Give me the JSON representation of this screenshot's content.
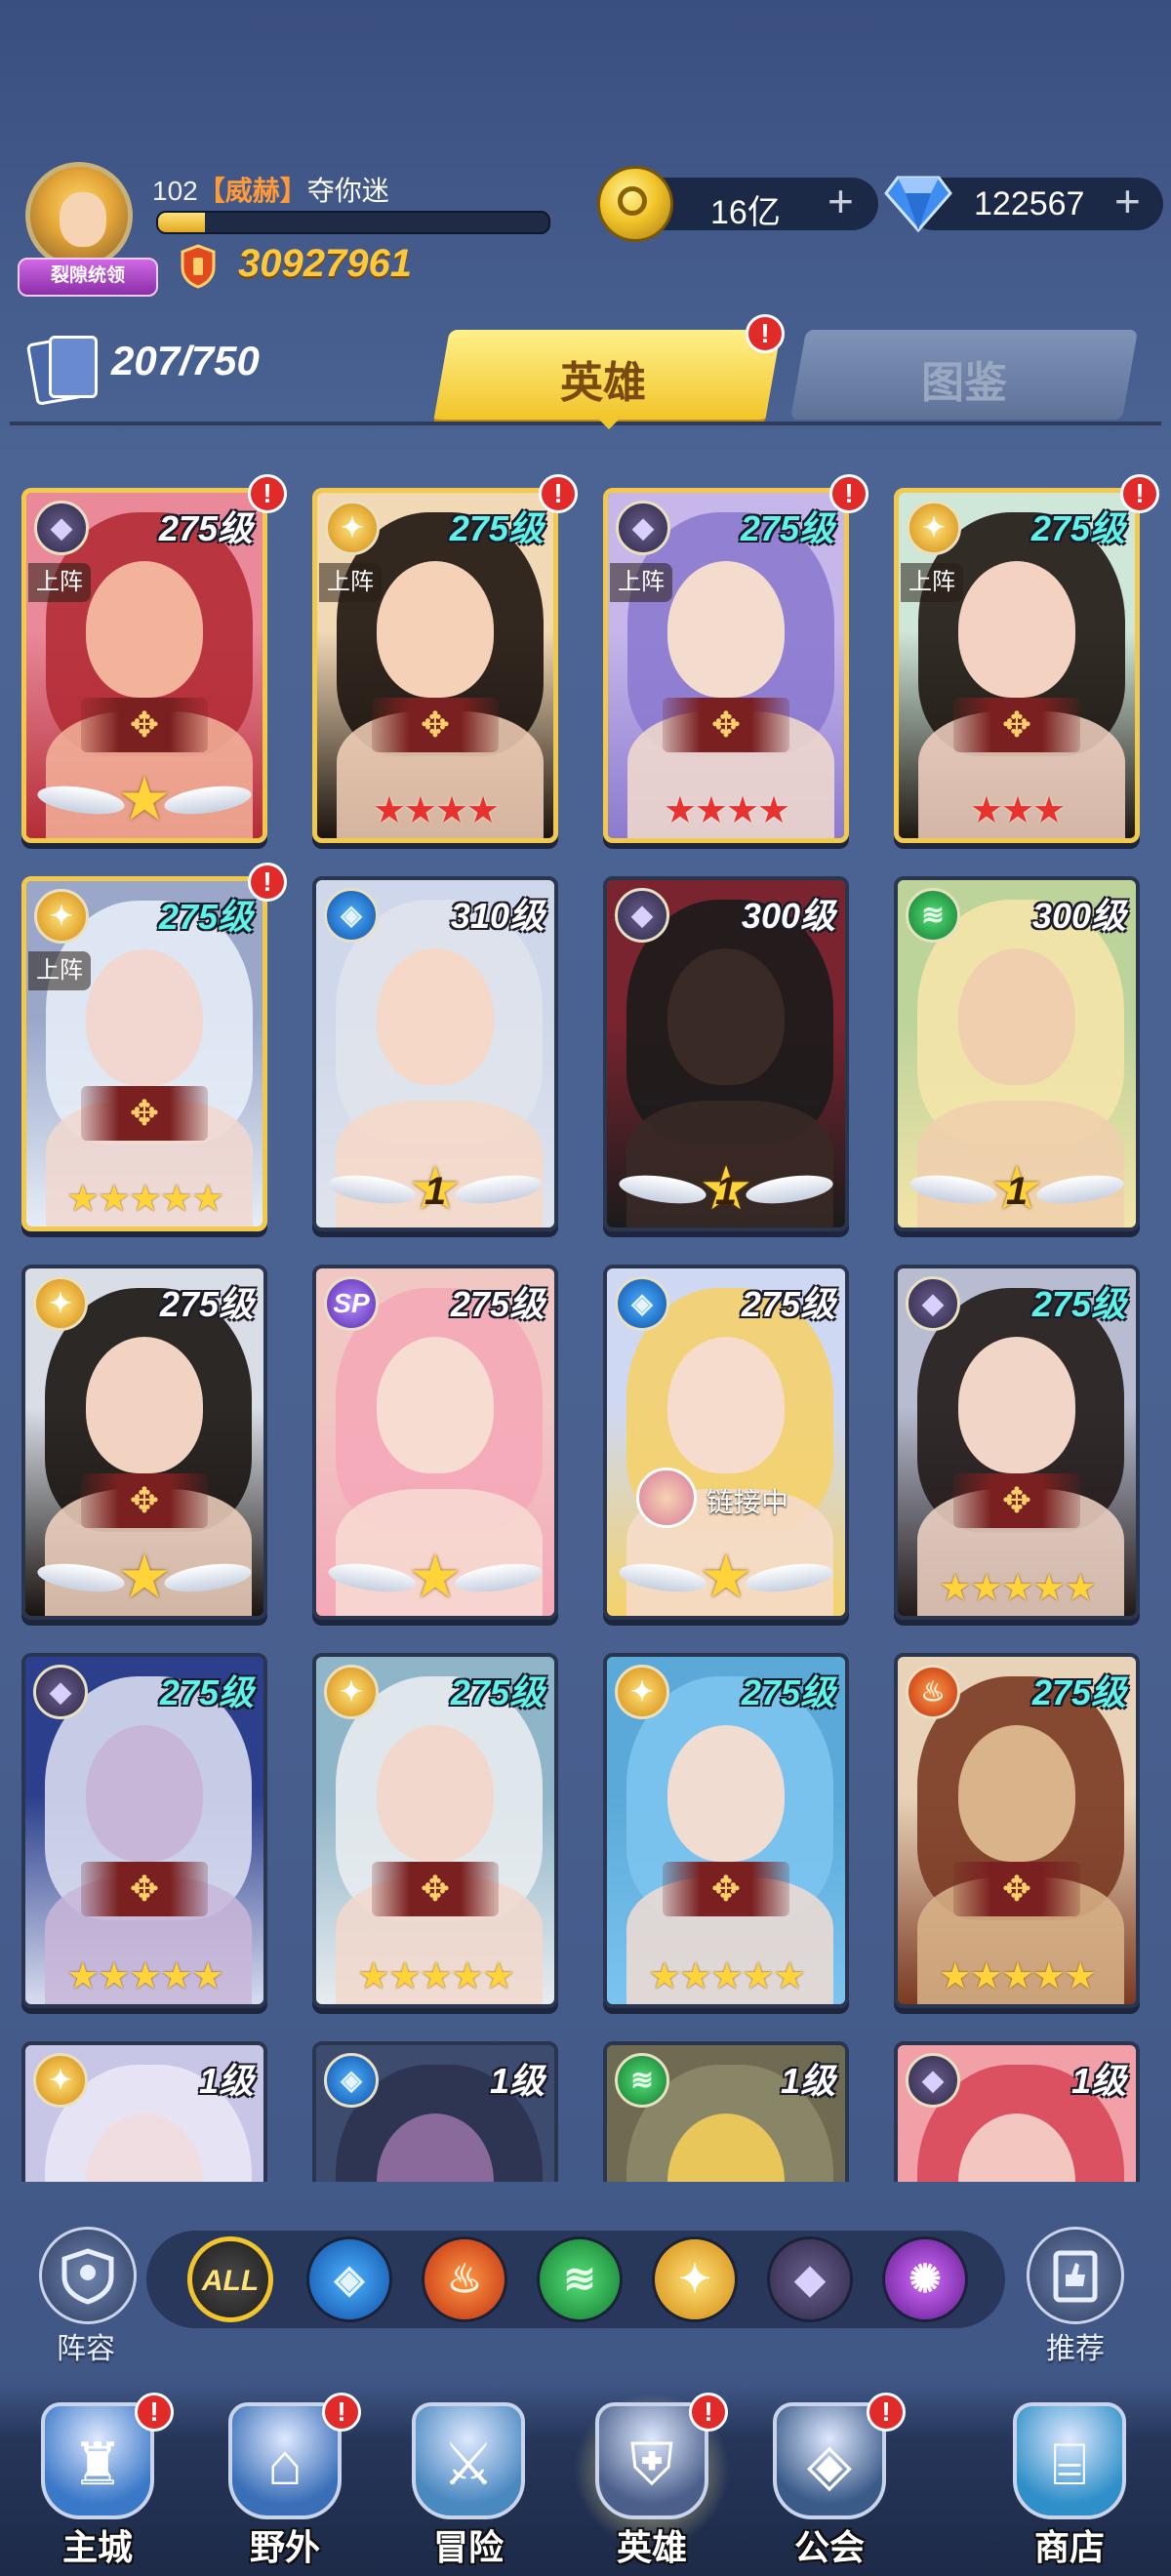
{
  "player": {
    "level": "102",
    "guild": "【威赫】",
    "name": "夺你迷",
    "title_badge": "裂隙统领",
    "xp_fraction": 0.12,
    "power": "30927961"
  },
  "resources": {
    "gold": "16亿",
    "gems": "122567",
    "plus": "+"
  },
  "hero_count": "207/750",
  "tabs": {
    "heroes": "英雄",
    "codex": "图鉴"
  },
  "deploy_label": "上阵",
  "linking_label": "链接中",
  "heroes": [
    {
      "level": "275级",
      "color": "white",
      "faction": "dark",
      "deployed": true,
      "stars": "wing",
      "stars_count": 0,
      "badge": true,
      "art": [
        "#e9899a",
        "#b42c36",
        "#f3b39a"
      ]
    },
    {
      "level": "275级",
      "color": "cyan",
      "faction": "light",
      "deployed": true,
      "stars": "red",
      "stars_count": 4,
      "badge": true,
      "art": [
        "#f1d9b5",
        "#1d1410",
        "#f5d1b8"
      ]
    },
    {
      "level": "275级",
      "color": "cyan",
      "faction": "dark",
      "deployed": true,
      "stars": "red",
      "stars_count": 4,
      "badge": true,
      "art": [
        "#c6b6ea",
        "#8c7ad0",
        "#f3dccd"
      ]
    },
    {
      "level": "275级",
      "color": "cyan",
      "faction": "light",
      "deployed": true,
      "stars": "red",
      "stars_count": 3,
      "badge": true,
      "art": [
        "#cfe7d9",
        "#1f1712",
        "#f4d2c2"
      ]
    },
    {
      "level": "275级",
      "color": "cyan",
      "faction": "light",
      "deployed": true,
      "stars": "gold",
      "stars_count": 5,
      "badge": true,
      "art": [
        "#9aa7c9",
        "#e6edf7",
        "#f1d7cf"
      ]
    },
    {
      "level": "310级",
      "color": "white",
      "faction": "water",
      "deployed": false,
      "stars": "wing",
      "stars_count": 1,
      "badge": false,
      "art": [
        "#cfd8ea",
        "#dfe3ec",
        "#f6d8c8"
      ]
    },
    {
      "level": "300级",
      "color": "white",
      "faction": "dark",
      "deployed": false,
      "stars": "wing",
      "stars_count": 1,
      "badge": false,
      "art": [
        "#7a2430",
        "#1b1b1b",
        "#3a2a26"
      ]
    },
    {
      "level": "300级",
      "color": "white",
      "faction": "wind",
      "deployed": false,
      "stars": "wing",
      "stars_count": 1,
      "badge": false,
      "art": [
        "#bcd39a",
        "#f4e4a8",
        "#f0cfae"
      ]
    },
    {
      "level": "275级",
      "color": "white",
      "faction": "light",
      "deployed": false,
      "stars": "wing",
      "stars_count": 0,
      "badge": false,
      "art": [
        "#d8dde6",
        "#1a1410",
        "#f2d3c1"
      ]
    },
    {
      "level": "275级",
      "color": "white",
      "faction": "sp",
      "deployed": false,
      "stars": "wing",
      "stars_count": 0,
      "badge": false,
      "art": [
        "#f0c7c3",
        "#f5a8b8",
        "#f7dcd2"
      ]
    },
    {
      "level": "275级",
      "color": "white",
      "faction": "water",
      "deployed": false,
      "stars": "wing",
      "stars_count": 0,
      "badge": false,
      "linking": true,
      "art": [
        "#cfd8f3",
        "#f4d26a",
        "#f6dccd"
      ]
    },
    {
      "level": "275级",
      "color": "cyan",
      "faction": "dark",
      "deployed": false,
      "stars": "gold",
      "stars_count": 5,
      "badge": false,
      "art": [
        "#b7bcd0",
        "#221a18",
        "#f1d5c6"
      ]
    },
    {
      "level": "275级",
      "color": "cyan",
      "faction": "dark",
      "deployed": false,
      "stars": "gold",
      "stars_count": 5,
      "badge": false,
      "art": [
        "#2b3f8c",
        "#d7dcef",
        "#c8b6d8"
      ]
    },
    {
      "level": "275级",
      "color": "cyan",
      "faction": "light",
      "deployed": false,
      "stars": "gold",
      "stars_count": 5,
      "badge": false,
      "art": [
        "#8fb5c8",
        "#e8ecef",
        "#f2d8cc"
      ]
    },
    {
      "level": "275级",
      "color": "cyan",
      "faction": "light",
      "deployed": false,
      "stars": "gold",
      "stars_count": 5,
      "badge": false,
      "art": [
        "#5ba9d8",
        "#7cc4f0",
        "#f1dcd2"
      ]
    },
    {
      "level": "275级",
      "color": "cyan",
      "faction": "fire",
      "deployed": false,
      "stars": "gold",
      "stars_count": 5,
      "badge": false,
      "art": [
        "#e8d3b8",
        "#7a3a22",
        "#d9b48a"
      ]
    },
    {
      "level": "1级",
      "color": "white",
      "faction": "light",
      "deployed": false,
      "stars": "none",
      "stars_count": 0,
      "badge": false,
      "art": [
        "#c8c6e6",
        "#e9e6f6",
        "#f0dde2"
      ]
    },
    {
      "level": "1级",
      "color": "white",
      "faction": "water",
      "deployed": false,
      "stars": "none",
      "stars_count": 0,
      "badge": false,
      "art": [
        "#3d4b6e",
        "#2c3350",
        "#8a6a9a"
      ]
    },
    {
      "level": "1级",
      "color": "white",
      "faction": "wind",
      "deployed": false,
      "stars": "none",
      "stars_count": 0,
      "badge": false,
      "art": [
        "#6f6a52",
        "#8c8a6a",
        "#e9c65a"
      ]
    },
    {
      "level": "1级",
      "color": "white",
      "faction": "dark",
      "deployed": false,
      "stars": "none",
      "stars_count": 0,
      "badge": false,
      "art": [
        "#f0a0a6",
        "#d8485a",
        "#f3c6c0"
      ]
    }
  ],
  "filters": [
    {
      "name": "all",
      "label": "ALL"
    },
    {
      "name": "water",
      "label": ""
    },
    {
      "name": "fire",
      "label": ""
    },
    {
      "name": "wind",
      "label": ""
    },
    {
      "name": "light",
      "label": ""
    },
    {
      "name": "dark",
      "label": ""
    },
    {
      "name": "chaos",
      "label": ""
    }
  ],
  "side_buttons": {
    "lineup": "阵容",
    "recommend": "推荐"
  },
  "nav": [
    {
      "label": "主城",
      "badge": true,
      "active": false
    },
    {
      "label": "野外",
      "badge": true,
      "active": false
    },
    {
      "label": "冒险",
      "badge": false,
      "active": false
    },
    {
      "label": "英雄",
      "badge": true,
      "active": true
    },
    {
      "label": "公会",
      "badge": true,
      "active": false
    },
    {
      "label": "商店",
      "badge": false,
      "active": false
    }
  ],
  "icons": {
    "power": "shield-icon",
    "gold": "coin-icon",
    "gems": "diamond-icon",
    "hero_count": "cards-icon",
    "badge": "exclamation-icon"
  },
  "colors": {
    "accent_gold": "#f2c52b",
    "level_cyan": "#5ff2e8",
    "badge_red": "#e12a2a",
    "guild_orange": "#ff9a3b"
  }
}
